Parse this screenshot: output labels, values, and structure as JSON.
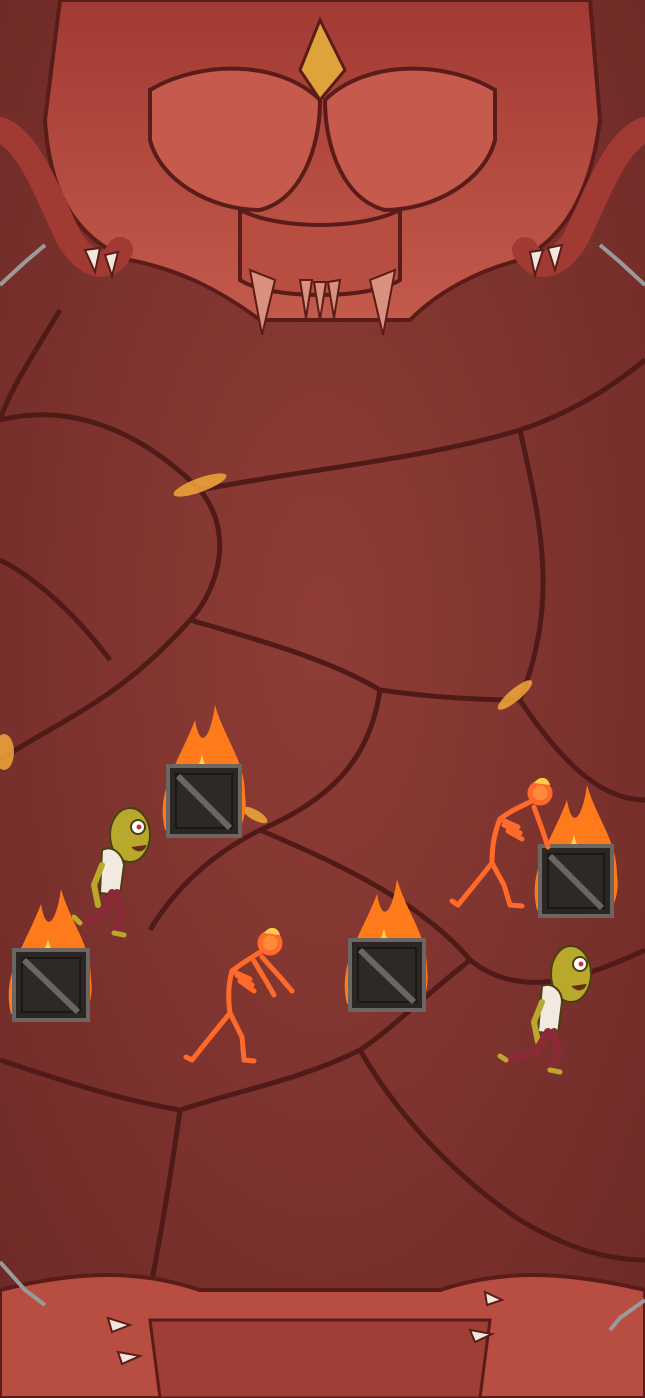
{
  "scene": {
    "name": "hell-dungeon-arena",
    "colors": {
      "floor": "#8a3a34",
      "floor_dark": "#6e2a27",
      "crack": "#4f1a18",
      "lava": "#f2a93b",
      "demon_face": "#b24a40",
      "demon_shadow": "#7a2a26",
      "crate": "#2b2623",
      "crate_frame": "#6b6661",
      "flame_outer": "#ff7a1a",
      "flame_inner": "#ffd54a",
      "zombie_skin": "#b8a92c",
      "skeleton": "#ff6a2a"
    },
    "objects": [
      {
        "type": "burning-crate",
        "icon": "crate-icon"
      },
      {
        "type": "burning-crate",
        "icon": "crate-icon"
      },
      {
        "type": "burning-crate",
        "icon": "crate-icon"
      },
      {
        "type": "burning-crate",
        "icon": "crate-icon"
      },
      {
        "type": "zombie",
        "icon": "zombie-icon"
      },
      {
        "type": "zombie",
        "icon": "zombie-icon"
      },
      {
        "type": "fire-skeleton",
        "icon": "skeleton-icon"
      },
      {
        "type": "fire-skeleton",
        "icon": "skeleton-icon"
      }
    ]
  }
}
